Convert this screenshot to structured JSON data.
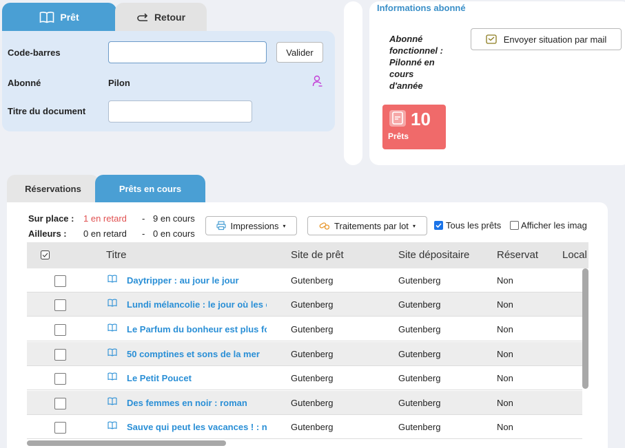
{
  "tabs_top": {
    "pret": "Prêt",
    "retour": "Retour"
  },
  "form": {
    "barcode_label": "Code-barres",
    "barcode_value": "",
    "valider_label": "Valider",
    "abonne_label": "Abonné",
    "abonne_value": "Pilon",
    "titre_label": "Titre du document",
    "titre_value": ""
  },
  "info": {
    "header": "Informations abonné",
    "status_lines": [
      "Abonné",
      "fonctionnel :",
      "Pilonné en",
      "cours",
      "d'année"
    ],
    "email_button": "Envoyer situation par mail",
    "loans_count": "10",
    "loans_label": "Prêts"
  },
  "tabs_bottom": {
    "reservations": "Réservations",
    "prets_en_cours": "Prêts en cours"
  },
  "summary": {
    "sur_place_label": "Sur place :",
    "sur_place_late": "1 en retard",
    "sur_place_current": "9 en cours",
    "ailleurs_label": "Ailleurs :",
    "ailleurs_late": "0 en retard",
    "ailleurs_current": "0 en cours",
    "separator": "-"
  },
  "toolbar": {
    "impressions": "Impressions",
    "traitements": "Traitements par lot",
    "tous_les_prets": "Tous les prêts",
    "tous_checked": true,
    "afficher_images": "Afficher les imag"
  },
  "grid": {
    "columns": [
      "Titre",
      "Site de prêt",
      "Site dépositaire",
      "Réservat",
      "Local"
    ],
    "rows": [
      {
        "title": "Daytripper : au jour le jour",
        "site_pret": "Gutenberg",
        "site_depositaire": "Gutenberg",
        "reservation": "Non"
      },
      {
        "title": "Lundi mélancolie : le jour où les e",
        "site_pret": "Gutenberg",
        "site_depositaire": "Gutenberg",
        "reservation": "Non"
      },
      {
        "title": "Le Parfum du bonheur est plus fo",
        "site_pret": "Gutenberg",
        "site_depositaire": "Gutenberg",
        "reservation": "Non"
      },
      {
        "title": "50 comptines et sons de la mer",
        "site_pret": "Gutenberg",
        "site_depositaire": "Gutenberg",
        "reservation": "Non"
      },
      {
        "title": "Le Petit Poucet",
        "site_pret": "Gutenberg",
        "site_depositaire": "Gutenberg",
        "reservation": "Non"
      },
      {
        "title": "Des femmes en noir : roman",
        "site_pret": "Gutenberg",
        "site_depositaire": "Gutenberg",
        "reservation": "Non"
      },
      {
        "title": "Sauve qui peut les vacances ! : no",
        "site_pret": "Gutenberg",
        "site_depositaire": "Gutenberg",
        "reservation": "Non"
      }
    ]
  },
  "colors": {
    "accent_blue": "#4a9fd4",
    "panel_blue": "#dde9f7",
    "late_red": "#e05050",
    "loans_tile": "#f06a6a",
    "title_link": "#2a8fd6",
    "info_header": "#3a8fc8"
  }
}
